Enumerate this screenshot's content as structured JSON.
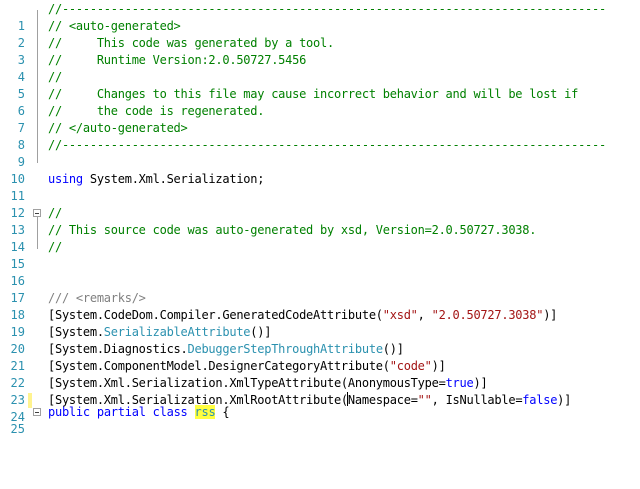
{
  "editor": {
    "line_numbers": [
      "1",
      "2",
      "3",
      "4",
      "5",
      "6",
      "7",
      "8",
      "9",
      "10",
      "11",
      "12",
      "13",
      "14",
      "15",
      "16",
      "17",
      "18",
      "19",
      "20",
      "21",
      "22",
      "23",
      "24",
      "25"
    ],
    "header": {
      "rule": "//------------------------------------------------------------------------------",
      "open_tag": "// <auto-generated>",
      "gen_by": "//     This code was generated by a tool.",
      "runtime": "//     Runtime Version:2.0.50727.5456",
      "blank": "//",
      "changes": "//     Changes to this file may cause incorrect behavior and will be lost if",
      "regen": "//     the code is regenerated.",
      "close_tag": "// </auto-generated>"
    },
    "using": {
      "keyword": "using",
      "namespace": " System.Xml.Serialization;"
    },
    "xsd_comment": {
      "open": "//",
      "text": "// This source code was auto-generated by xsd, Version=2.0.50727.3038.",
      "close": "//"
    },
    "remarks": {
      "slashes": "///",
      "tag": " <remarks/>"
    },
    "attr19": {
      "pre": "[System.CodeDom.Compiler.GeneratedCodeAttribute(",
      "s1": "\"xsd\"",
      "sep": ", ",
      "s2": "\"2.0.50727.3038\"",
      "post": ")]"
    },
    "attr20": {
      "pre": "[System.",
      "type": "SerializableAttribute",
      "post": "()]"
    },
    "attr21": {
      "pre": "[System.Diagnostics.",
      "type": "DebuggerStepThroughAttribute",
      "post": "()]"
    },
    "attr22": {
      "pre": "[System.ComponentModel.DesignerCategoryAttribute(",
      "s1": "\"code\"",
      "post": ")]"
    },
    "attr23": {
      "pre": "[System.Xml.Serialization.XmlTypeAttribute(AnonymousType=",
      "kw": "true",
      "post": ")]"
    },
    "attr24": {
      "pre": "[System.Xml.Serialization.XmlRootAttribute(",
      "ns": "Namespace=",
      "s1": "\"\"",
      "mid": ", IsNullable=",
      "kw": "false",
      "post": ")]"
    },
    "class_decl": {
      "kw1": "public",
      "kw2": "partial",
      "kw3": "class",
      "name": "rss",
      "brace": " {"
    }
  }
}
